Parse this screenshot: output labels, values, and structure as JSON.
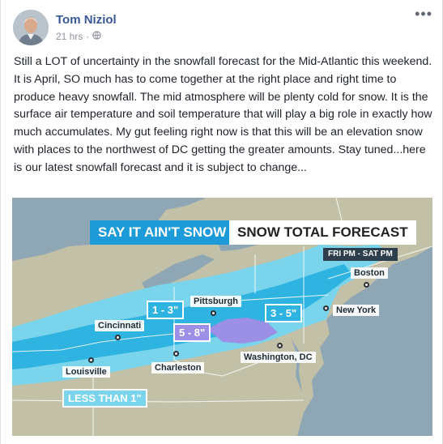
{
  "post": {
    "author": "Tom Niziol",
    "time": "21 hrs",
    "separator": "·",
    "privacy_icon": "globe-icon",
    "more_icon": "more-options-icon",
    "text": "Still a LOT of uncertainty in the snowfall forecast for the Mid-Atlantic this weekend. It is April, SO much has to come together at the right place and right time to produce heavy snowfall. The mid atmosphere will be plenty cold for snow. It is the surface air temperature and soil temperature that will play a big role in exactly how much accumulates. My gut feeling right now is that this will be an elevation snow with places to the northwest of DC getting the greater amounts. Stay tuned...here is our latest snowfall forecast and it is subject to change..."
  },
  "map": {
    "title_left": "SAY IT AIN'T SNOW",
    "title_right": "SNOW TOTAL FORECAST",
    "time_range": "FRI PM - SAT PM",
    "ranges": {
      "light": "1 - 3\"",
      "moderate": "3 - 5\"",
      "heavy": "5 - 8\"",
      "minimal": "LESS THAN 1\""
    },
    "cities": {
      "boston": "Boston",
      "new_york": "New York",
      "pittsburgh": "Pittsburgh",
      "cincinnati": "Cincinnati",
      "washington": "Washington, DC",
      "charleston": "Charleston",
      "louisville": "Louisville"
    },
    "colors": {
      "water": "#8fa6b4",
      "land": "#c2c1a8",
      "snow_light": "#79d4ec",
      "snow_moderate": "#2fb3e0",
      "snow_heavy": "#9b8fe6",
      "title_blue": "#1d9bd8"
    }
  }
}
